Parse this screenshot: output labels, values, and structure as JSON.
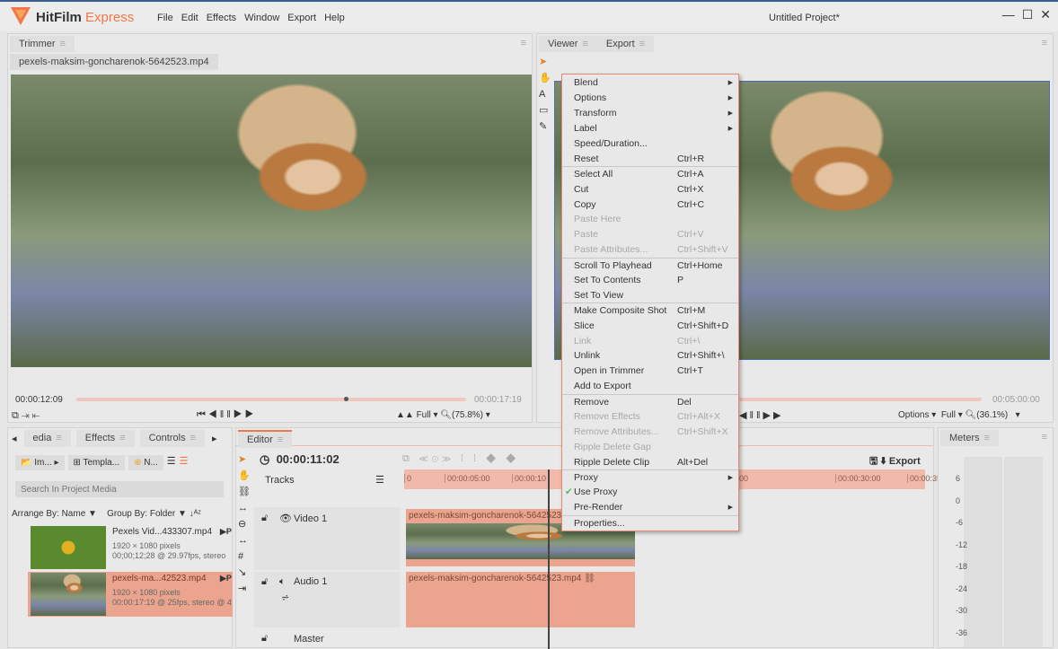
{
  "app": {
    "name": "HitFilm",
    "edition": "Express",
    "project_title": "Untitled Project*",
    "menu": [
      "File",
      "Edit",
      "Effects",
      "Window",
      "Export",
      "Help"
    ],
    "window_controls": [
      "minimize",
      "maximize",
      "close"
    ]
  },
  "trimmer": {
    "tab": "Trimmer",
    "file_tab": "pexels-maksim-goncharenok-5642523.mp4",
    "current_time": "00:00:12:09",
    "end_time": "00:00:17:19",
    "playhead_fraction": 0.69,
    "quality": "Full",
    "zoom": "(75.8%)"
  },
  "viewer": {
    "tabs": [
      "Viewer",
      "Export"
    ],
    "end_time": "00:05:00:00",
    "options": "Options",
    "quality": "Full",
    "zoom": "(36.1%)"
  },
  "context_menu": [
    {
      "label": "Blend",
      "submenu": true
    },
    {
      "label": "Options",
      "submenu": true
    },
    {
      "label": "Transform",
      "submenu": true
    },
    {
      "label": "Label",
      "submenu": true
    },
    {
      "label": "Speed/Duration..."
    },
    {
      "label": "Reset",
      "shortcut": "Ctrl+R",
      "sep_after": true
    },
    {
      "label": "Select All",
      "shortcut": "Ctrl+A"
    },
    {
      "label": "Cut",
      "shortcut": "Ctrl+X"
    },
    {
      "label": "Copy",
      "shortcut": "Ctrl+C"
    },
    {
      "label": "Paste Here",
      "disabled": true
    },
    {
      "label": "Paste",
      "shortcut": "Ctrl+V",
      "disabled": true
    },
    {
      "label": "Paste Attributes...",
      "shortcut": "Ctrl+Shift+V",
      "disabled": true,
      "sep_after": true
    },
    {
      "label": "Scroll To Playhead",
      "shortcut": "Ctrl+Home"
    },
    {
      "label": "Set To Contents",
      "shortcut": "P"
    },
    {
      "label": "Set To View",
      "sep_after": true
    },
    {
      "label": "Make Composite Shot",
      "shortcut": "Ctrl+M"
    },
    {
      "label": "Slice",
      "shortcut": "Ctrl+Shift+D"
    },
    {
      "label": "Link",
      "shortcut": "Ctrl+\\",
      "disabled": true
    },
    {
      "label": "Unlink",
      "shortcut": "Ctrl+Shift+\\"
    },
    {
      "label": "Open in Trimmer",
      "shortcut": "Ctrl+T"
    },
    {
      "label": "Add to Export",
      "sep_after": true
    },
    {
      "label": "Remove",
      "shortcut": "Del"
    },
    {
      "label": "Remove Effects",
      "shortcut": "Ctrl+Alt+X",
      "disabled": true
    },
    {
      "label": "Remove Attributes...",
      "shortcut": "Ctrl+Shift+X",
      "disabled": true
    },
    {
      "label": "Ripple Delete Gap",
      "disabled": true
    },
    {
      "label": "Ripple Delete Clip",
      "shortcut": "Alt+Del",
      "sep_after": true
    },
    {
      "label": "Proxy",
      "submenu": true
    },
    {
      "label": "Use Proxy",
      "checked": true
    },
    {
      "label": "Pre-Render",
      "submenu": true,
      "sep_after": true
    },
    {
      "label": "Properties..."
    }
  ],
  "media": {
    "tabs": [
      "edia",
      "Effects",
      "Controls"
    ],
    "import": "Im...",
    "templates": "Templa...",
    "new": "N...",
    "search_placeholder": "Search In Project Media",
    "arrange": "Arrange By: Name",
    "group": "Group By: Folder",
    "items": [
      {
        "name": "Pexels Vid...433307.mp4",
        "res": "1920 × 1080 pixels",
        "info": "00;00;12;28 @ 29.97fps, stereo",
        "selected": false
      },
      {
        "name": "pexels-ma...42523.mp4",
        "res": "1920 × 1080 pixels",
        "info": "00:00:17:19 @ 25fps, stereo @ 4",
        "selected": true
      }
    ]
  },
  "editor": {
    "tab": "Editor",
    "timecode": "00:00:11:02",
    "tracks_label": "Tracks",
    "export": "Export",
    "ruler": [
      "0",
      "00:00:05:00",
      "00:00:10",
      "00",
      "00:00:30:00",
      "00:00:35:00",
      "00:00"
    ],
    "tracks": [
      {
        "name": "Video 1",
        "clip": "pexels-maksim-goncharenok-5642523.mp4"
      },
      {
        "name": "Audio 1",
        "clip": "pexels-maksim-goncharenok-5642523.mp4"
      },
      {
        "name": "Master"
      }
    ]
  },
  "meters": {
    "tab": "Meters",
    "scale": [
      "6",
      "0",
      "-6",
      "-12",
      "-18",
      "-24",
      "-30",
      "-36"
    ]
  },
  "colors": {
    "accent": "#f0774a",
    "selection": "#eba48e",
    "ruler": "#f0b9a9"
  }
}
